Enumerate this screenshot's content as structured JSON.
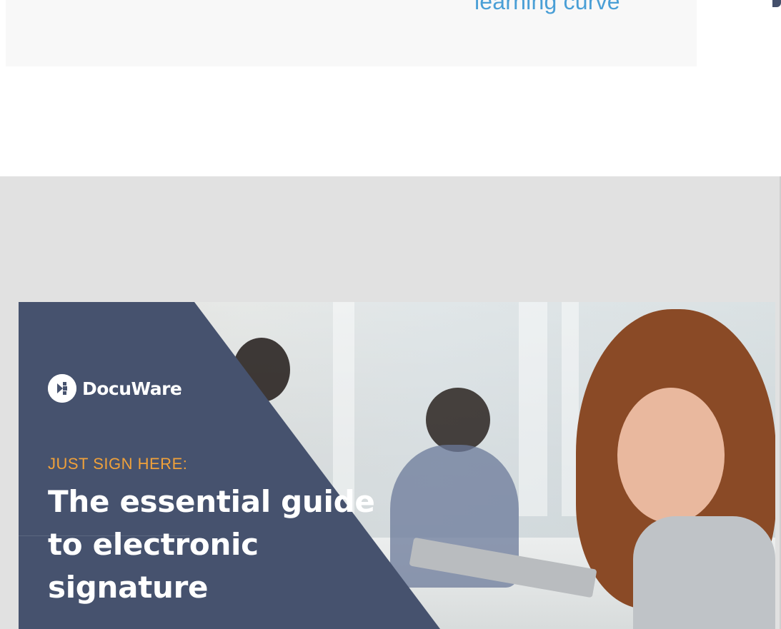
{
  "top_card": {
    "link_text": "learning curve"
  },
  "banner": {
    "brand": "DocuWare",
    "eyebrow": "JUST SIGN HERE:",
    "headline": "The essential guide to electronic signature"
  },
  "icons": {
    "brand_logo": "docuware-logo-icon",
    "edge": "social-share-icon"
  },
  "colors": {
    "link": "#4a9fd6",
    "panel": "#46526e",
    "eyebrow": "#f0a13a",
    "section_bg": "#e1e1e1"
  }
}
